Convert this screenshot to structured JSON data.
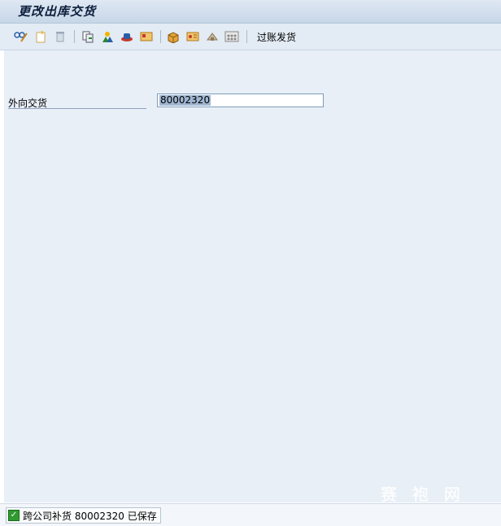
{
  "window": {
    "title": "更改出库交货"
  },
  "toolbar": {
    "icons": [
      "display-change-icon",
      "new-document-icon",
      "delete-icon",
      "copy-document-icon",
      "partner-icon",
      "header-icon",
      "item-overview-icon",
      "packing-icon",
      "picking-icon",
      "shipment-icon",
      "output-icon"
    ],
    "post_goods_issue_label": "过账发货"
  },
  "form": {
    "outbound_delivery_label": "外向交货",
    "outbound_delivery_value": "80002320"
  },
  "status": {
    "type": "success",
    "message": "跨公司补货 80002320 已保存"
  },
  "watermark": {
    "text": "赛 袍 网"
  },
  "colors": {
    "accent": "#0b1d3a",
    "success": "#2e9b2e",
    "selection": "#9fb6d2"
  }
}
